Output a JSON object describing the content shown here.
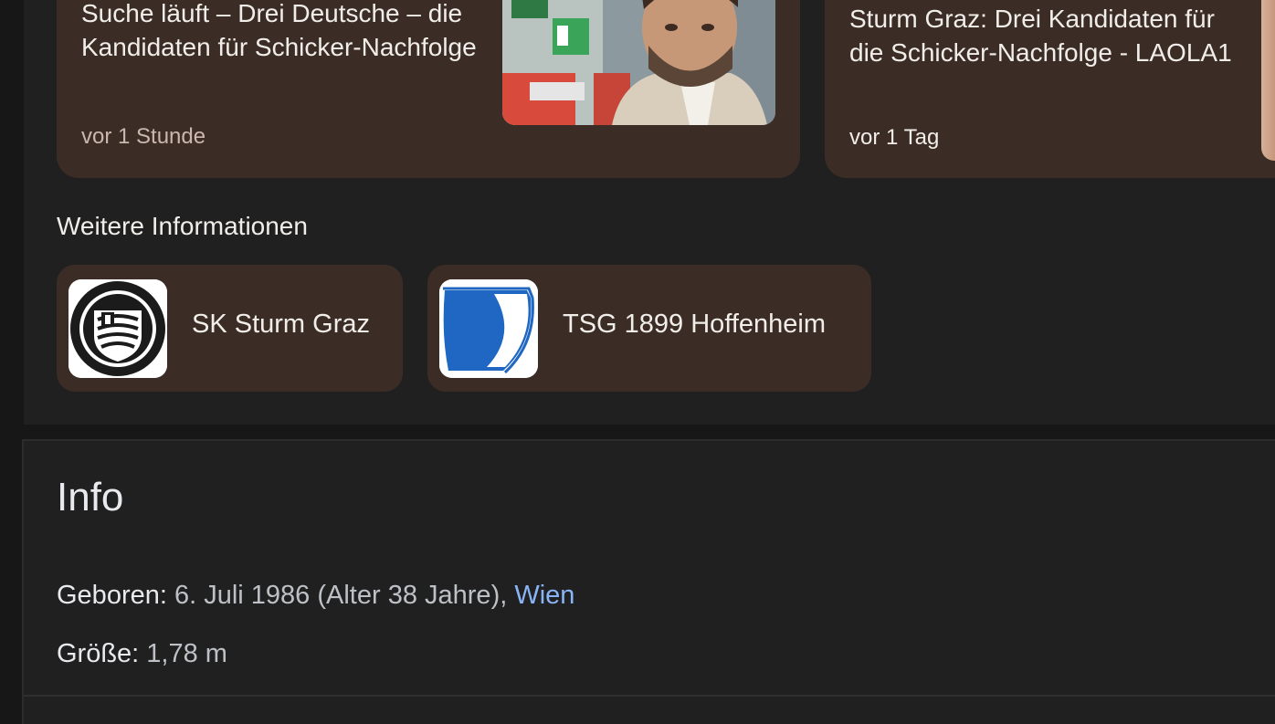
{
  "news": [
    {
      "title": "Suche läuft – Drei Deutsche – die Kandidaten für Schicker-Nachfolge",
      "time": "vor 1 Stunde"
    },
    {
      "title": "Sturm Graz: Drei Kandidaten für die Schicker-Nachfolge - LAOLA1",
      "time": "vor 1 Tag"
    }
  ],
  "more_info": {
    "heading": "Weitere Informationen",
    "items": [
      {
        "label": "SK Sturm Graz",
        "icon": "sk-sturm-graz-crest"
      },
      {
        "label": "TSG 1899 Hoffenheim",
        "icon": "tsg-hoffenheim-crest"
      }
    ]
  },
  "info": {
    "title": "Info",
    "born_label": "Geboren:",
    "born_value": " 6. Juli 1986 (Alter 38 Jahre), ",
    "born_place": "Wien",
    "height_label": "Größe:",
    "height_value": " 1,78 m"
  },
  "colors": {
    "page_bg": "#171717",
    "panel_bg": "#202020",
    "card_bg": "#3b2d26",
    "link": "#8ab4f8"
  }
}
